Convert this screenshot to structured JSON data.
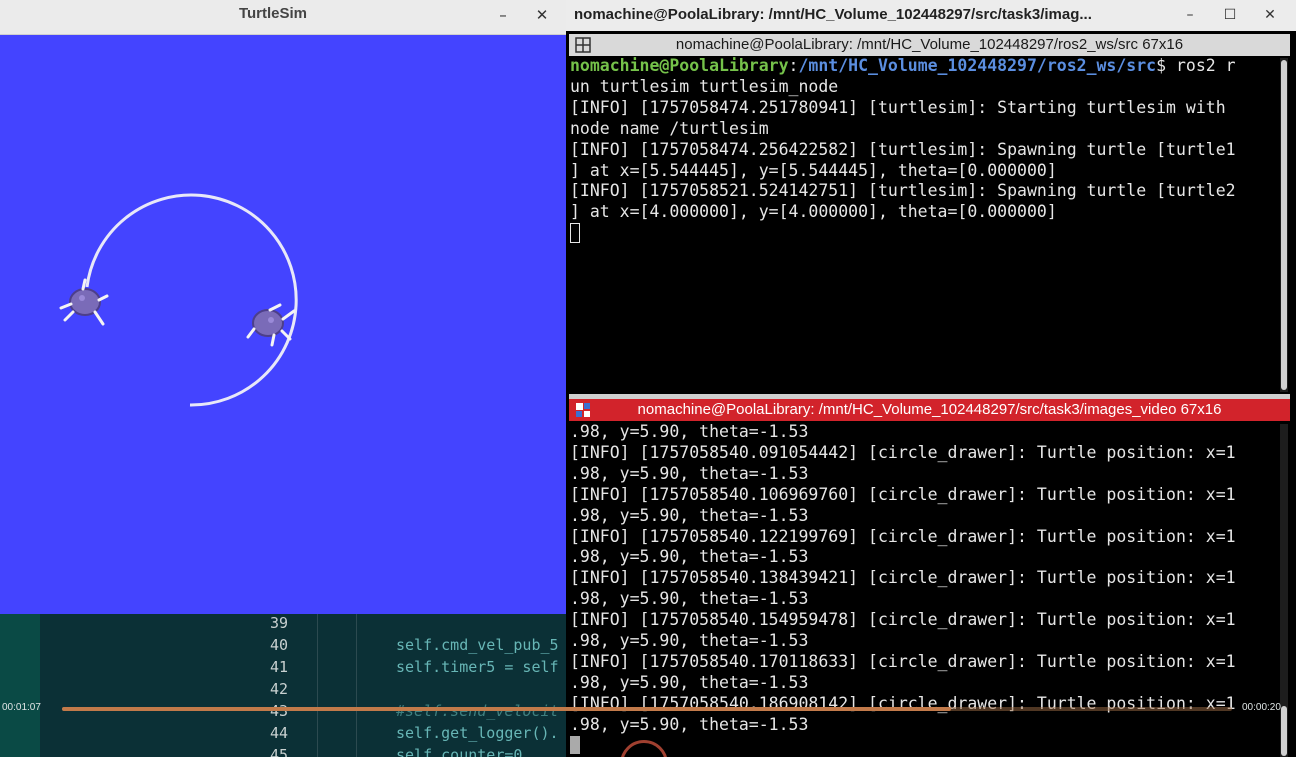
{
  "editor": {
    "lines": [
      {
        "num": "39",
        "code": "",
        "comment": false
      },
      {
        "num": "40",
        "code": "self.cmd_vel_pub_5",
        "comment": false
      },
      {
        "num": "41",
        "code": "self.timer5 = self",
        "comment": false
      },
      {
        "num": "42",
        "code": "",
        "comment": false
      },
      {
        "num": "43",
        "code": "#self.send_velocit",
        "comment": true
      },
      {
        "num": "44",
        "code": "self.get_logger().",
        "comment": false
      },
      {
        "num": "45",
        "code": "self.counter=0",
        "comment": false
      }
    ]
  },
  "turtlesim": {
    "title": "TurtleSim",
    "minimize": "–",
    "close": "✕",
    "background": "#4444ff"
  },
  "terminal": {
    "title": "nomachine@PoolaLibrary: /mnt/HC_Volume_102448297/src/task3/imag...",
    "minimize": "–",
    "maximize": "☐",
    "close": "✕",
    "pane1": {
      "header": "nomachine@PoolaLibrary: /mnt/HC_Volume_102448297/ros2_ws/src 67x16",
      "prompt_user": "nomachine@PoolaLibrary",
      "prompt_colon": ":",
      "prompt_path": "/mnt/HC_Volume_102448297/ros2_ws/src",
      "prompt_dollar": "$ ros2 r",
      "lines": [
        "un turtlesim turtlesim_node",
        "[INFO] [1757058474.251780941] [turtlesim]: Starting turtlesim with",
        "node name /turtlesim",
        "[INFO] [1757058474.256422582] [turtlesim]: Spawning turtle [turtle1",
        "] at x=[5.544445], y=[5.544445], theta=[0.000000]",
        "[INFO] [1757058521.524142751] [turtlesim]: Spawning turtle [turtle2",
        "] at x=[4.000000], y=[4.000000], theta=[0.000000]"
      ]
    },
    "pane2": {
      "header": "nomachine@PoolaLibrary: /mnt/HC_Volume_102448297/src/task3/images_video 67x16",
      "lines": [
        ".98, y=5.90, theta=-1.53",
        "[INFO] [1757058540.091054442] [circle_drawer]: Turtle position: x=1",
        ".98, y=5.90, theta=-1.53",
        "[INFO] [1757058540.106969760] [circle_drawer]: Turtle position: x=1",
        ".98, y=5.90, theta=-1.53",
        "[INFO] [1757058540.122199769] [circle_drawer]: Turtle position: x=1",
        ".98, y=5.90, theta=-1.53",
        "[INFO] [1757058540.138439421] [circle_drawer]: Turtle position: x=1",
        ".98, y=5.90, theta=-1.53",
        "[INFO] [1757058540.154959478] [circle_drawer]: Turtle position: x=1",
        ".98, y=5.90, theta=-1.53",
        "[INFO] [1757058540.170118633] [circle_drawer]: Turtle position: x=1",
        ".98, y=5.90, theta=-1.53",
        "[INFO] [1757058540.186908142] [circle_drawer]: Turtle position: x=1",
        ".98, y=5.90, theta=-1.53"
      ]
    }
  },
  "video": {
    "time_elapsed": "00:01:07",
    "time_total": "00:00:20",
    "progress_fraction": 0.76
  }
}
